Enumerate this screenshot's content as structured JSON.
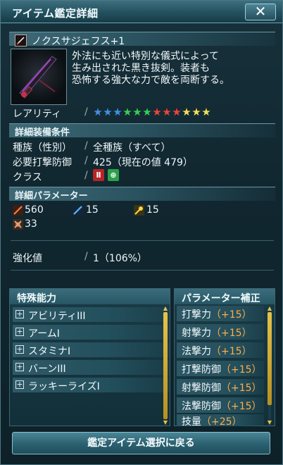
{
  "window": {
    "title": "アイテム鑑定詳細",
    "close_glyph": "✕"
  },
  "item": {
    "name": "ノクスサジェフス+1",
    "description": [
      "外法にも近い特別な儀式によって",
      "生み出された黒き抜剣。装者も",
      "恐怖する強大な力で敵を両断する。"
    ]
  },
  "rarity": {
    "label": "レアリティ",
    "stars": [
      {
        "color": "#3f8fe8"
      },
      {
        "color": "#3f8fe8"
      },
      {
        "color": "#3f8fe8"
      },
      {
        "color": "#36d14f"
      },
      {
        "color": "#36d14f"
      },
      {
        "color": "#36d14f"
      },
      {
        "color": "#f0433a"
      },
      {
        "color": "#f0433a"
      },
      {
        "color": "#f0433a"
      },
      {
        "color": "#f2de5a"
      },
      {
        "color": "#f2de5a"
      },
      {
        "color": "#f2de5a"
      }
    ]
  },
  "equip": {
    "section_label": "詳細装備条件",
    "race_label": "種族（性別）",
    "race_value": "全種族（すべて）",
    "req_label": "必要打撃防御",
    "req_value": "425（現在の値 479）",
    "class_label": "クラス",
    "classes": [
      {
        "icon": "hunter-class-icon",
        "glyph": "Ⅱ",
        "color": "#b8232a"
      },
      {
        "icon": "fighter-class-icon",
        "glyph": "⊕",
        "color": "#2aa14a"
      }
    ]
  },
  "params": {
    "section_label": "詳細パラメーター",
    "attack": "560",
    "ranged": "15",
    "skill": "15",
    "defense": "33"
  },
  "enhance": {
    "label": "強化値",
    "value": "1（106%）"
  },
  "abilities": {
    "header": "特殊能力",
    "items": [
      "アビリティIII",
      "アームI",
      "スタミナI",
      "バーンIII",
      "ラッキーライズI"
    ]
  },
  "param_bonus": {
    "header": "パラメーター補正",
    "items": [
      {
        "name": "打撃力",
        "bonus": "（+15）"
      },
      {
        "name": "射撃力",
        "bonus": "（+15）"
      },
      {
        "name": "法撃力",
        "bonus": "（+15）"
      },
      {
        "name": "打撃防御",
        "bonus": "（+15）"
      },
      {
        "name": "射撃防御",
        "bonus": "（+15）"
      },
      {
        "name": "法撃防御",
        "bonus": "（+15）"
      },
      {
        "name": "技量",
        "bonus": "（+25）"
      }
    ]
  },
  "footer": {
    "back_button": "鑑定アイテム選択に戻る"
  }
}
